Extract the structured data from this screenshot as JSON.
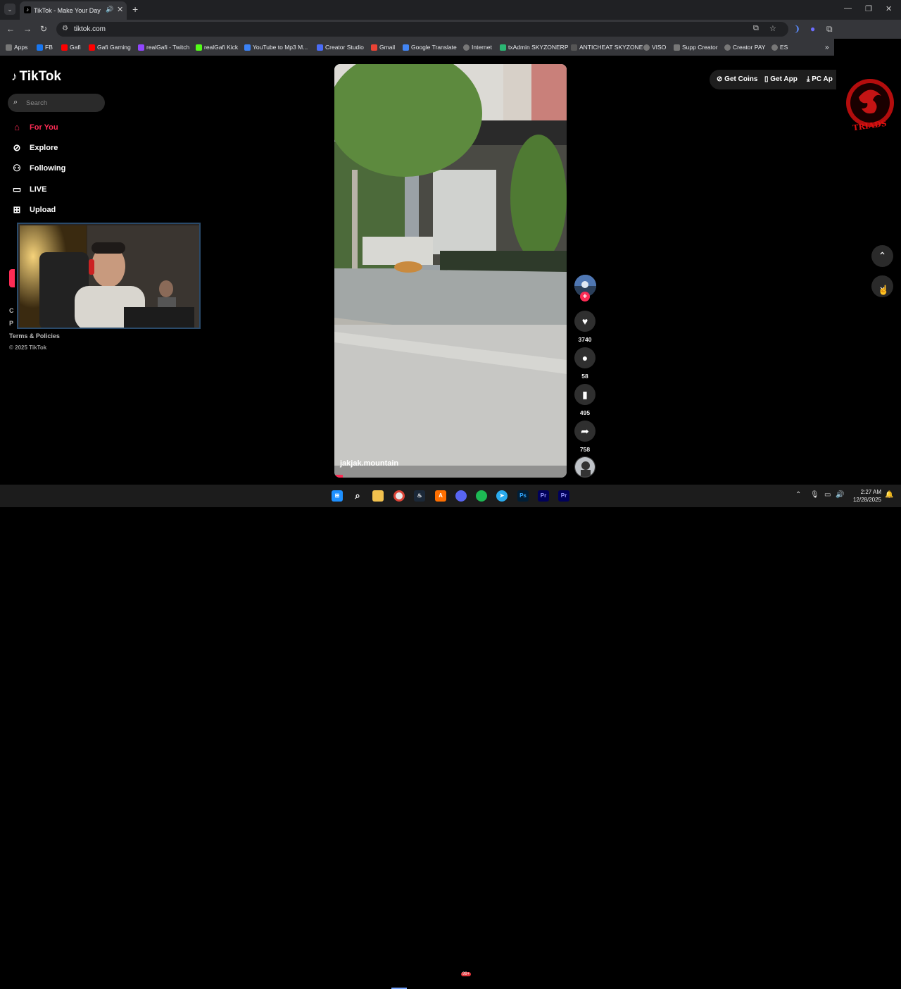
{
  "browser": {
    "tab_title": "TikTok - Make Your Day",
    "tab_menu_icon": "chevron-down-icon",
    "url": "tiktok.com",
    "bookmarks": [
      {
        "label": "Apps",
        "color": "#888888"
      },
      {
        "label": "FB",
        "color": "#1877f2"
      },
      {
        "label": "Gafi",
        "color": "#ff0000"
      },
      {
        "label": "Gafi Gaming",
        "color": "#ff0000"
      },
      {
        "label": "realGafi - Twitch",
        "color": "#9146ff"
      },
      {
        "label": "realGafi Kick",
        "color": "#53fc18"
      },
      {
        "label": "YouTube to Mp3 M...",
        "color": "#3b82f6"
      },
      {
        "label": "Creator Studio",
        "color": "#4a6cf7"
      },
      {
        "label": "Gmail",
        "color": "#ea4335"
      },
      {
        "label": "Google Translate",
        "color": "#4285f4"
      },
      {
        "label": "Internet",
        "color": "#aaaaaa"
      },
      {
        "label": "txAdmin SKYZONERP",
        "color": "#2bb673"
      },
      {
        "label": "ANTICHEAT SKYZONE",
        "color": "#555555"
      },
      {
        "label": "VISO",
        "color": "#aaaaaa"
      },
      {
        "label": "Supp Creator",
        "color": "#aaaaaa"
      },
      {
        "label": "Creator PAY",
        "color": "#aaaaaa"
      },
      {
        "label": "ES",
        "color": "#aaaaaa"
      }
    ]
  },
  "tiktok": {
    "logo": "TikTok",
    "search_placeholder": "Search",
    "nav": [
      {
        "label": "For You",
        "icon": "home-icon",
        "active": true
      },
      {
        "label": "Explore",
        "icon": "compass-icon",
        "active": false
      },
      {
        "label": "Following",
        "icon": "user-follow-icon",
        "active": false
      },
      {
        "label": "LIVE",
        "icon": "live-tv-icon",
        "active": false
      },
      {
        "label": "Upload",
        "icon": "plus-square-icon",
        "active": false
      }
    ],
    "footer": {
      "terms": "Terms & Policies",
      "copyright": "© 2025 TikTok"
    },
    "top_buttons": {
      "coins": "Get Coins",
      "app": "Get App",
      "pc_app": "PC Ap"
    },
    "video": {
      "author": "jakjak.mountain",
      "likes": "3740",
      "comments": "58",
      "saves": "495",
      "shares": "758"
    },
    "accent": "#fe2c55"
  },
  "taskbar": {
    "time": "2:27 AM",
    "date": "12/28/2025",
    "discord_badge": "99+"
  }
}
